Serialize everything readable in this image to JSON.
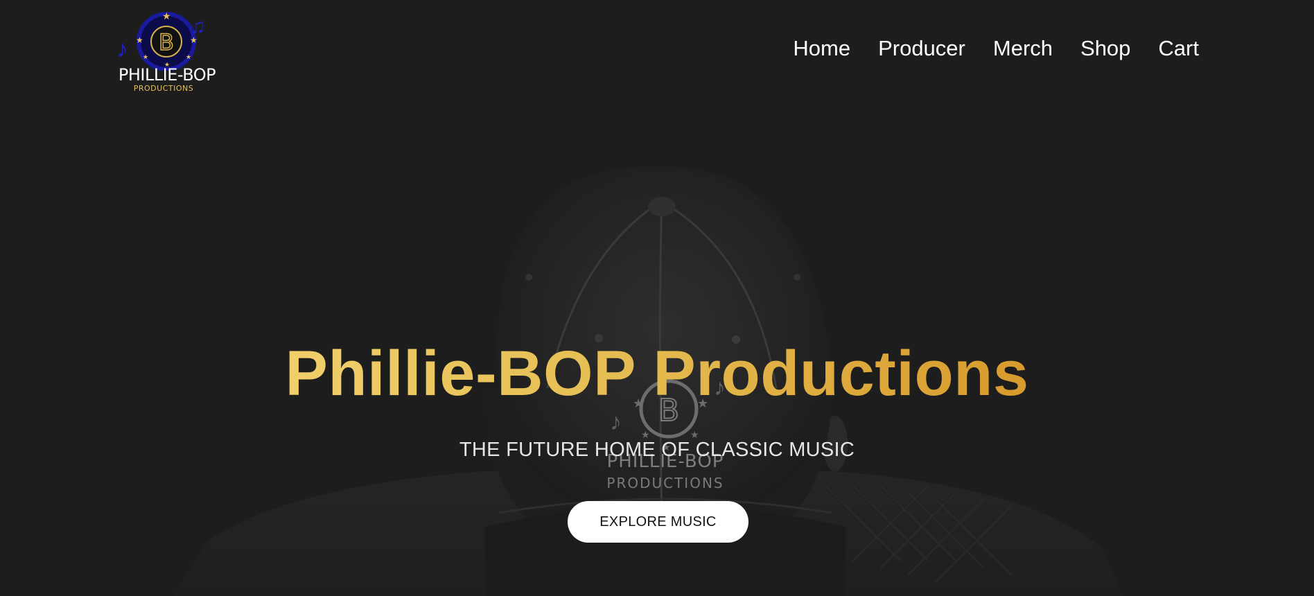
{
  "brand": {
    "name": "PHILLIE-BOP",
    "sub": "PRODUCTIONS",
    "emblem_letter": "B"
  },
  "nav": {
    "items": [
      {
        "label": "Home"
      },
      {
        "label": "Producer"
      },
      {
        "label": "Merch"
      },
      {
        "label": "Shop"
      },
      {
        "label": "Cart"
      }
    ]
  },
  "hero": {
    "title": "Phillie-BOP Productions",
    "subtitle": "THE FUTURE HOME OF CLASSIC MUSIC",
    "cta_label": "EXPLORE MUSIC",
    "cap_text": "PHILLIE-BOP",
    "cap_sub": "PRODUCTIONS",
    "cap_letter": "B"
  },
  "colors": {
    "background": "#1d1d1d",
    "accent_gold": "#e5bd52",
    "logo_blue": "#1a1a9c"
  }
}
